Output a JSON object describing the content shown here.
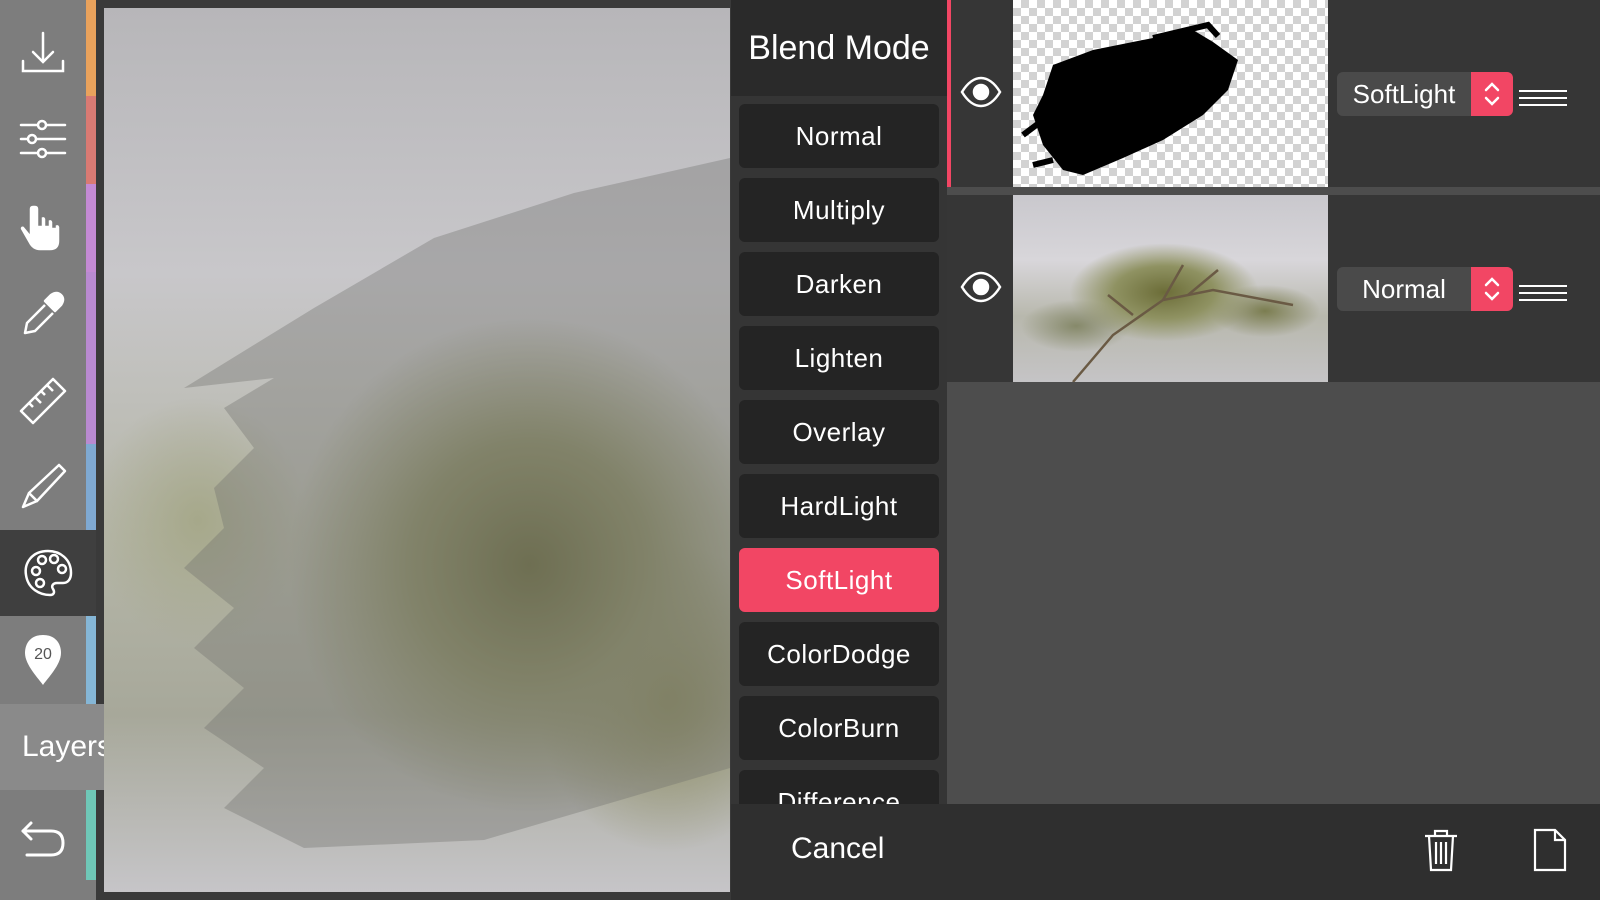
{
  "toolbar": {
    "tools": [
      {
        "name": "download-icon"
      },
      {
        "name": "adjustments-icon"
      },
      {
        "name": "hand-icon"
      },
      {
        "name": "eyedropper-icon"
      },
      {
        "name": "ruler-icon"
      },
      {
        "name": "brush-icon"
      },
      {
        "name": "palette-icon",
        "active": true
      },
      {
        "name": "brush-size-pin-icon"
      }
    ],
    "brush_size": "20",
    "layers_label": "Layers",
    "undo_icon": "undo-icon",
    "stripe_colors": [
      "#e9a25c",
      "#d97a73",
      "#c48ad4",
      "#b98ad1",
      "#7fa9d2",
      "#85b6d6",
      "#6fc7b7"
    ]
  },
  "blend": {
    "title": "Blend Mode",
    "modes": [
      "Normal",
      "Multiply",
      "Darken",
      "Lighten",
      "Overlay",
      "HardLight",
      "SoftLight",
      "ColorDodge",
      "ColorBurn",
      "Difference"
    ],
    "selected": "SoftLight"
  },
  "layers": [
    {
      "mode": "SoftLight",
      "visible": true,
      "active": true,
      "thumbnail": "brush-stroke-on-transparent"
    },
    {
      "mode": "Normal",
      "visible": true,
      "active": false,
      "thumbnail": "pine-branch-photo"
    }
  ],
  "bottom": {
    "cancel_label": "Cancel",
    "delete_icon": "trash-icon",
    "new_layer_icon": "new-page-icon"
  },
  "colors": {
    "accent": "#f24664",
    "toolbar_bg": "#7d7d7d",
    "panel_bg": "#363636"
  }
}
